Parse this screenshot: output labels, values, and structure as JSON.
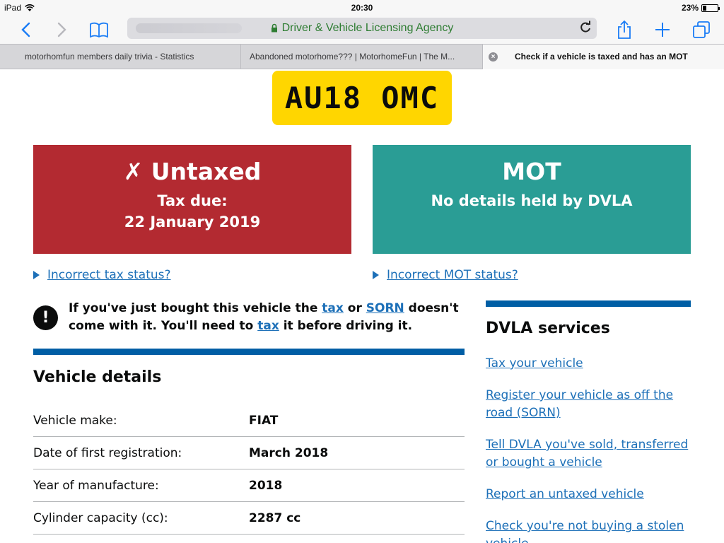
{
  "status_bar": {
    "device": "iPad",
    "time": "20:30",
    "battery_text": "23%",
    "battery_level": 0.23
  },
  "browser": {
    "address_text": "Driver & Vehicle Licensing Agency",
    "tabs": [
      {
        "label": "motorhomfun members daily trivia - Statistics"
      },
      {
        "label": "Abandoned motorhome??? | MotorhomeFun | The M..."
      },
      {
        "label": "Check if a vehicle is taxed and has an MOT"
      }
    ],
    "tab_close_glyph": "×"
  },
  "plate": "AU18 OMC",
  "tax_panel": {
    "title": "✗ Untaxed",
    "subtitle": "Tax due:",
    "date": "22 January 2019",
    "color": "#b32a31"
  },
  "mot_panel": {
    "title": "MOT",
    "subtitle": "No details held by DVLA",
    "color": "#2a9d95"
  },
  "links": {
    "incorrect_tax": "Incorrect tax status?",
    "incorrect_mot": "Incorrect MOT status?"
  },
  "warning": {
    "icon": "!",
    "part1": "If you've just bought this vehicle the ",
    "link_tax1": "tax",
    "part2": " or ",
    "link_sorn": "SORN",
    "part3": " doesn't come with it. You'll need to ",
    "link_tax2": "tax",
    "part4": " it before driving it."
  },
  "vehicle_details": {
    "title": "Vehicle details",
    "rows": [
      {
        "label": "Vehicle make:",
        "value": "FIAT"
      },
      {
        "label": "Date of first registration:",
        "value": "March 2018"
      },
      {
        "label": "Year of manufacture:",
        "value": "2018"
      },
      {
        "label": "Cylinder capacity (cc):",
        "value": "2287 cc"
      }
    ]
  },
  "dvla_services": {
    "title": "DVLA services",
    "items": [
      "Tax your vehicle",
      "Register your vehicle as off the road (SORN)",
      "Tell DVLA you've sold, transferred or bought a vehicle",
      "Report an untaxed vehicle",
      "Check you're not buying a stolen vehicle"
    ]
  },
  "colors": {
    "link": "#1d70b8",
    "rule": "#005ea5",
    "plate": "#ffd600",
    "address_text": "#2e7d32"
  }
}
